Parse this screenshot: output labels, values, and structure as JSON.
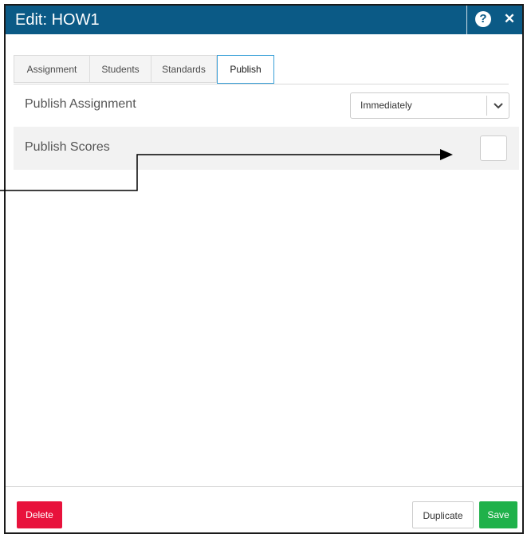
{
  "window": {
    "title": "Edit: HOW1",
    "help_icon": "question-circle-icon",
    "help_glyph": "?",
    "close_icon": "close-icon",
    "close_glyph": "✕"
  },
  "tabs": [
    {
      "label": "Assignment",
      "active": false
    },
    {
      "label": "Students",
      "active": false
    },
    {
      "label": "Standards",
      "active": false
    },
    {
      "label": "Publish",
      "active": true
    }
  ],
  "publish_assignment": {
    "label": "Publish Assignment",
    "selected": "Immediately",
    "chevron_icon": "chevron-down-icon"
  },
  "publish_scores": {
    "label": "Publish Scores",
    "checked": false
  },
  "footer": {
    "delete_label": "Delete",
    "duplicate_label": "Duplicate",
    "save_label": "Save"
  },
  "colors": {
    "titlebar": "#0b5a86",
    "delete": "#e8123c",
    "save": "#1fb14a",
    "active_tab_border": "#3aa0d8"
  }
}
